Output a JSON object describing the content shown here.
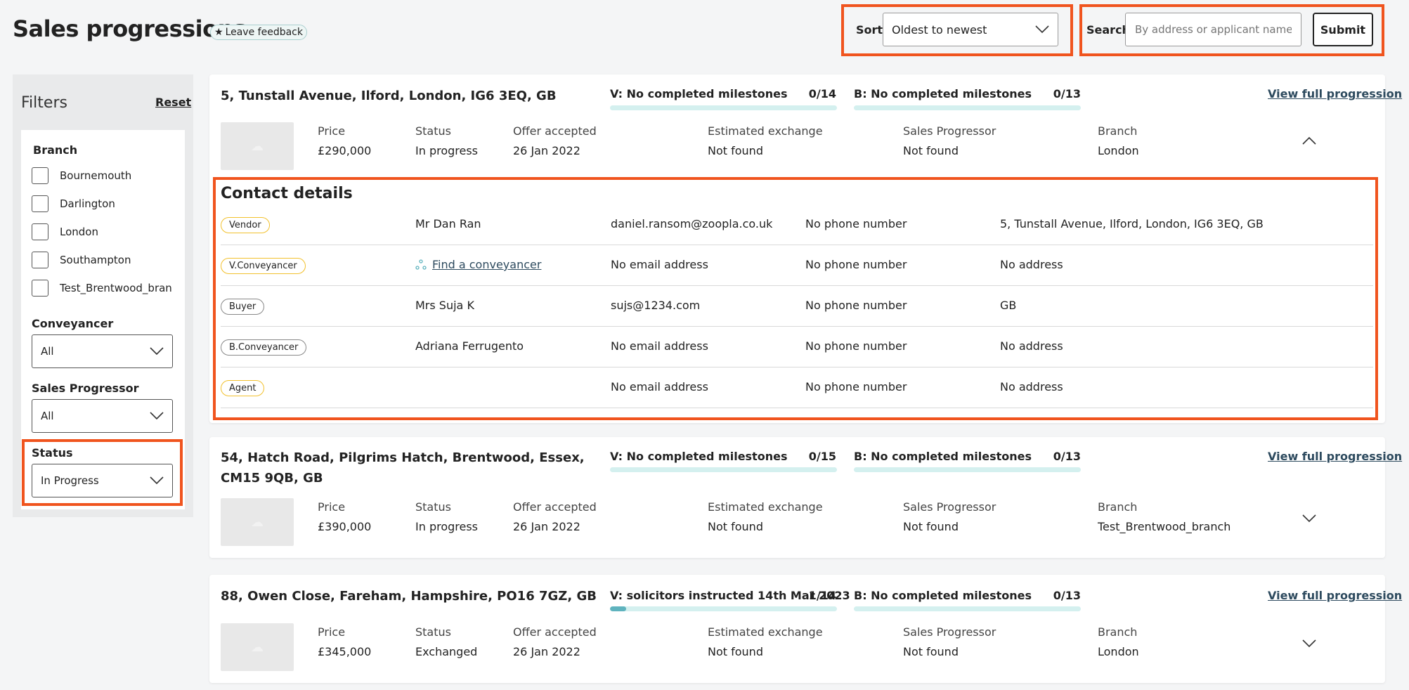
{
  "header": {
    "title": "Sales progressions",
    "feedback": "Leave feedback",
    "sort_label": "Sort",
    "sort_value": "Oldest to newest",
    "search_label": "Search",
    "search_placeholder": "By address or applicant name",
    "submit_label": "Submit"
  },
  "filters": {
    "title": "Filters",
    "reset": "Reset",
    "branch_heading": "Branch",
    "branches": [
      "Bournemouth",
      "Darlington",
      "London",
      "Southampton",
      "Test_Brentwood_bran"
    ],
    "conveyancer_heading": "Conveyancer",
    "conveyancer_value": "All",
    "progressor_heading": "Sales Progressor",
    "progressor_value": "All",
    "status_heading": "Status",
    "status_value": "In Progress"
  },
  "field_labels": {
    "price": "Price",
    "status": "Status",
    "offer": "Offer accepted",
    "exchange": "Estimated exchange",
    "progressor": "Sales Progressor",
    "branch": "Branch",
    "view_link": "View full progression"
  },
  "cards": [
    {
      "address": "5, Tunstall Avenue, Ilford, London, IG6 3EQ, GB",
      "v_milestone": "V: No completed milestones",
      "v_count": "0/14",
      "v_progress": 0,
      "b_milestone": "B: No completed milestones",
      "b_count": "0/13",
      "b_progress": 0,
      "price": "£290,000",
      "status": "In progress",
      "offer": "26 Jan 2022",
      "exchange": "Not found",
      "progressor": "Not found",
      "branch": "London",
      "expanded": true
    },
    {
      "address": "54, Hatch Road, Pilgrims Hatch, Brentwood, Essex, CM15 9QB, GB",
      "v_milestone": "V: No completed milestones",
      "v_count": "0/15",
      "v_progress": 0,
      "b_milestone": "B: No completed milestones",
      "b_count": "0/13",
      "b_progress": 0,
      "price": "£390,000",
      "status": "In progress",
      "offer": "26 Jan 2022",
      "exchange": "Not found",
      "progressor": "Not found",
      "branch": "Test_Brentwood_branch",
      "expanded": false
    },
    {
      "address": "88, Owen Close, Fareham, Hampshire, PO16 7GZ, GB",
      "v_milestone": "V: solicitors instructed 14th Mar 2023",
      "v_count": "1/14",
      "v_progress": 0.0714,
      "b_milestone": "B: No completed milestones",
      "b_count": "0/13",
      "b_progress": 0,
      "price": "£345,000",
      "status": "Exchanged",
      "offer": "26 Jan 2022",
      "exchange": "Not found",
      "progressor": "Not found",
      "branch": "London",
      "expanded": false
    }
  ],
  "contacts": {
    "title": "Contact details",
    "rows": [
      {
        "role": "Vendor",
        "name": "Mr Dan Ran",
        "email": "daniel.ransom@zoopla.co.uk",
        "phone": "No phone number",
        "address": "5, Tunstall Avenue, Ilford, London, IG6 3EQ, GB",
        "pill_color": "#f2c12e"
      },
      {
        "role": "V.Conveyancer",
        "name": "Find a conveyancer",
        "email": "No email address",
        "phone": "No phone number",
        "address": "No address",
        "pill_color": "#f2c12e"
      },
      {
        "role": "Buyer",
        "name": "Mrs Suja K",
        "email": "sujs@1234.com",
        "phone": "No phone number",
        "address": "GB",
        "pill_color": "#888888"
      },
      {
        "role": "B.Conveyancer",
        "name": "Adriana Ferrugento",
        "email": "No email address",
        "phone": "No phone number",
        "address": "No address",
        "pill_color": "#888888"
      },
      {
        "role": "Agent",
        "name": "",
        "email": "No email address",
        "phone": "No phone number",
        "address": "No address",
        "pill_color": "#f2c12e"
      }
    ]
  },
  "colors": {
    "highlight": "#f0541e",
    "progress_fill": "#5fb3be",
    "progress_track": "#d4f0ef",
    "link": "#2d4a5e"
  }
}
